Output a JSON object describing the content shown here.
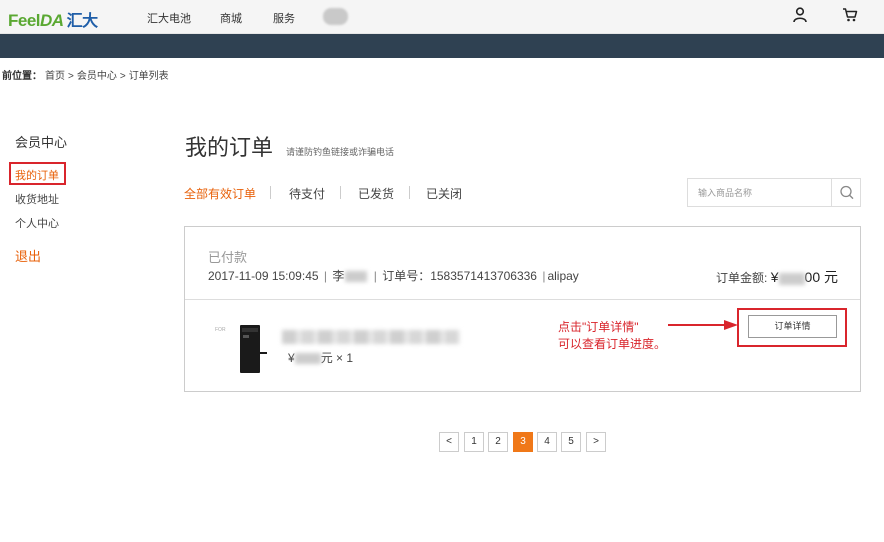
{
  "header": {
    "logo": {
      "feel": "Feel",
      "da": "DA",
      "cn": "汇大"
    },
    "nav": [
      "汇大电池",
      "商城",
      "服务"
    ]
  },
  "breadcrumb": {
    "prefix": "前位置：",
    "items": [
      "首页",
      ">",
      "会员中心",
      ">",
      "订单列表"
    ]
  },
  "sidebar": {
    "title": "会员中心",
    "items": [
      "我的订单",
      "收货地址",
      "个人中心"
    ],
    "logout": "退出"
  },
  "main": {
    "title": "我的订单",
    "subtitle": "请谨防钓鱼链接或诈骗电话",
    "tabs": [
      "全部有效订单",
      "待支付",
      "已发货",
      "已关闭"
    ],
    "search": {
      "placeholder": "输入商品名称"
    }
  },
  "order": {
    "status": "已付款",
    "datetime": "2017-11-09 15:09:45",
    "buyer_prefix": "李",
    "order_no_label": "订单号：",
    "order_no": "1583571413706336",
    "payment": "alipay",
    "amount_label": "订单金额:",
    "amount_prefix": "¥",
    "amount_suffix": "00 元",
    "price_prefix": "¥",
    "price_suffix": "元 × 1",
    "detail_button": "订单详情"
  },
  "annotation": {
    "line1": "点击\"订单详情\"",
    "line2": "可以查看订单进度。"
  },
  "pagination": {
    "prev": "<",
    "pages": [
      "1",
      "2",
      "3",
      "4",
      "5"
    ],
    "active_page": "3",
    "next": ">"
  },
  "colors": {
    "accent": "#e8610a",
    "highlight": "#d9252c",
    "banner": "#2f4152",
    "page_active": "#f07818"
  }
}
